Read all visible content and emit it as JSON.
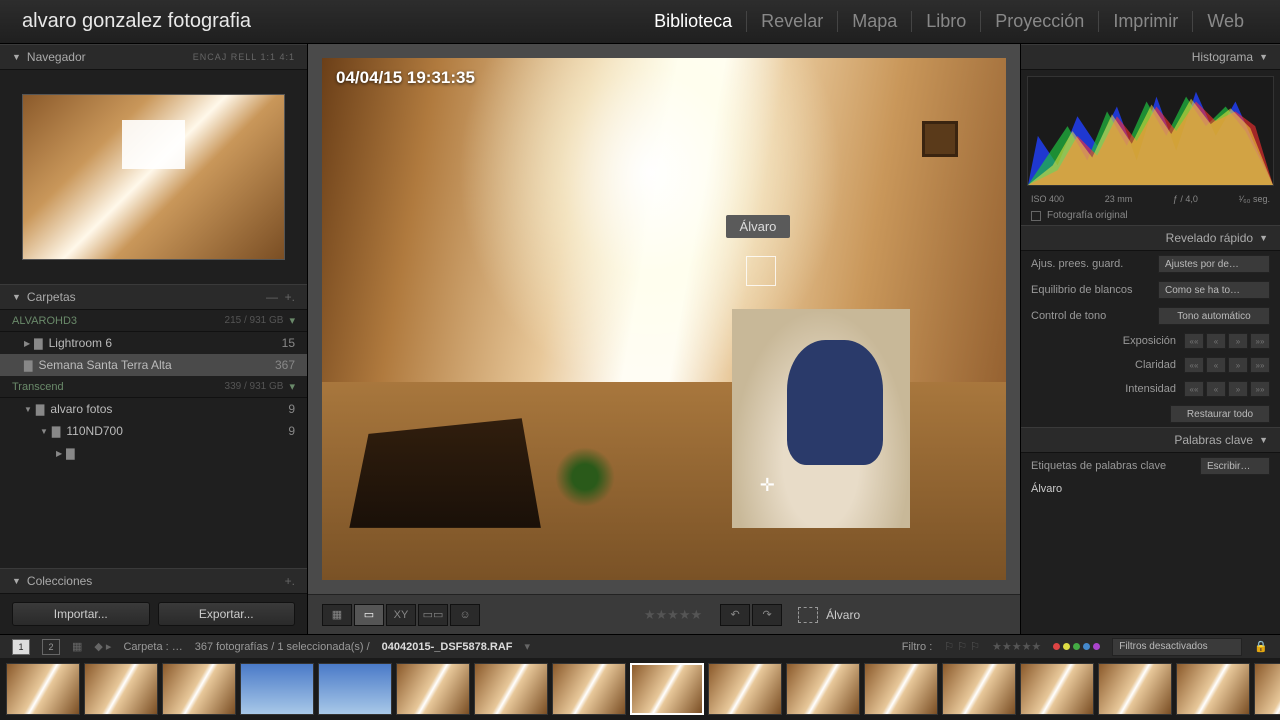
{
  "identity": "alvaro gonzalez fotografia",
  "modules": [
    "Biblioteca",
    "Revelar",
    "Mapa",
    "Libro",
    "Proyección",
    "Imprimir",
    "Web"
  ],
  "active_module": "Biblioteca",
  "navigator": {
    "title": "Navegador",
    "modes": "ENCAJ  RELL  1:1  4:1"
  },
  "folders": {
    "title": "Carpetas",
    "volumes": [
      {
        "name": "ALVAROHD3",
        "stat": "215 / 931 GB",
        "items": [
          {
            "name": "Lightroom 6",
            "count": "15"
          },
          {
            "name": "Semana Santa Terra Alta",
            "count": "367",
            "selected": true
          }
        ]
      },
      {
        "name": "Transcend",
        "stat": "339 / 931 GB",
        "items": [
          {
            "name": "alvaro fotos",
            "count": "9",
            "children": [
              {
                "name": "110ND700",
                "count": "9",
                "children": [
                  {
                    "name": "",
                    "count": ""
                  }
                ]
              }
            ]
          }
        ]
      }
    ]
  },
  "collections": {
    "title": "Colecciones"
  },
  "import_btn": "Importar...",
  "export_btn": "Exportar...",
  "photo": {
    "timestamp": "04/04/15 19:31:35",
    "face_label": "Álvaro"
  },
  "toolbar_face": "Álvaro",
  "histogram": {
    "title": "Histograma",
    "iso": "ISO 400",
    "focal": "23 mm",
    "aperture": "ƒ / 4,0",
    "shutter": "¹⁄₆₀ seg.",
    "orig": "Fotografía original"
  },
  "quickdev": {
    "title": "Revelado rápido",
    "preset_lbl": "Ajus. prees. guard.",
    "preset_val": "Ajustes por de…",
    "wb_lbl": "Equilibrio de blancos",
    "wb_val": "Como se ha to…",
    "tone_lbl": "Control de tono",
    "tone_btn": "Tono automático",
    "expo": "Exposición",
    "clar": "Claridad",
    "vib": "Intensidad",
    "reset": "Restaurar todo"
  },
  "keywords": {
    "title": "Palabras clave",
    "tags_lbl": "Etiquetas de palabras clave",
    "tags_btn": "Escribir…",
    "person": "Álvaro"
  },
  "status": {
    "folder": "Carpeta : …",
    "count": "367 fotografías / 1 seleccionada(s) /",
    "file": "04042015-_DSF5878.RAF",
    "filter": "Filtro :",
    "filters_off": "Filtros desactivados"
  },
  "colors": [
    "#d44",
    "#dd4",
    "#4a4",
    "#48c",
    "#a4c"
  ]
}
